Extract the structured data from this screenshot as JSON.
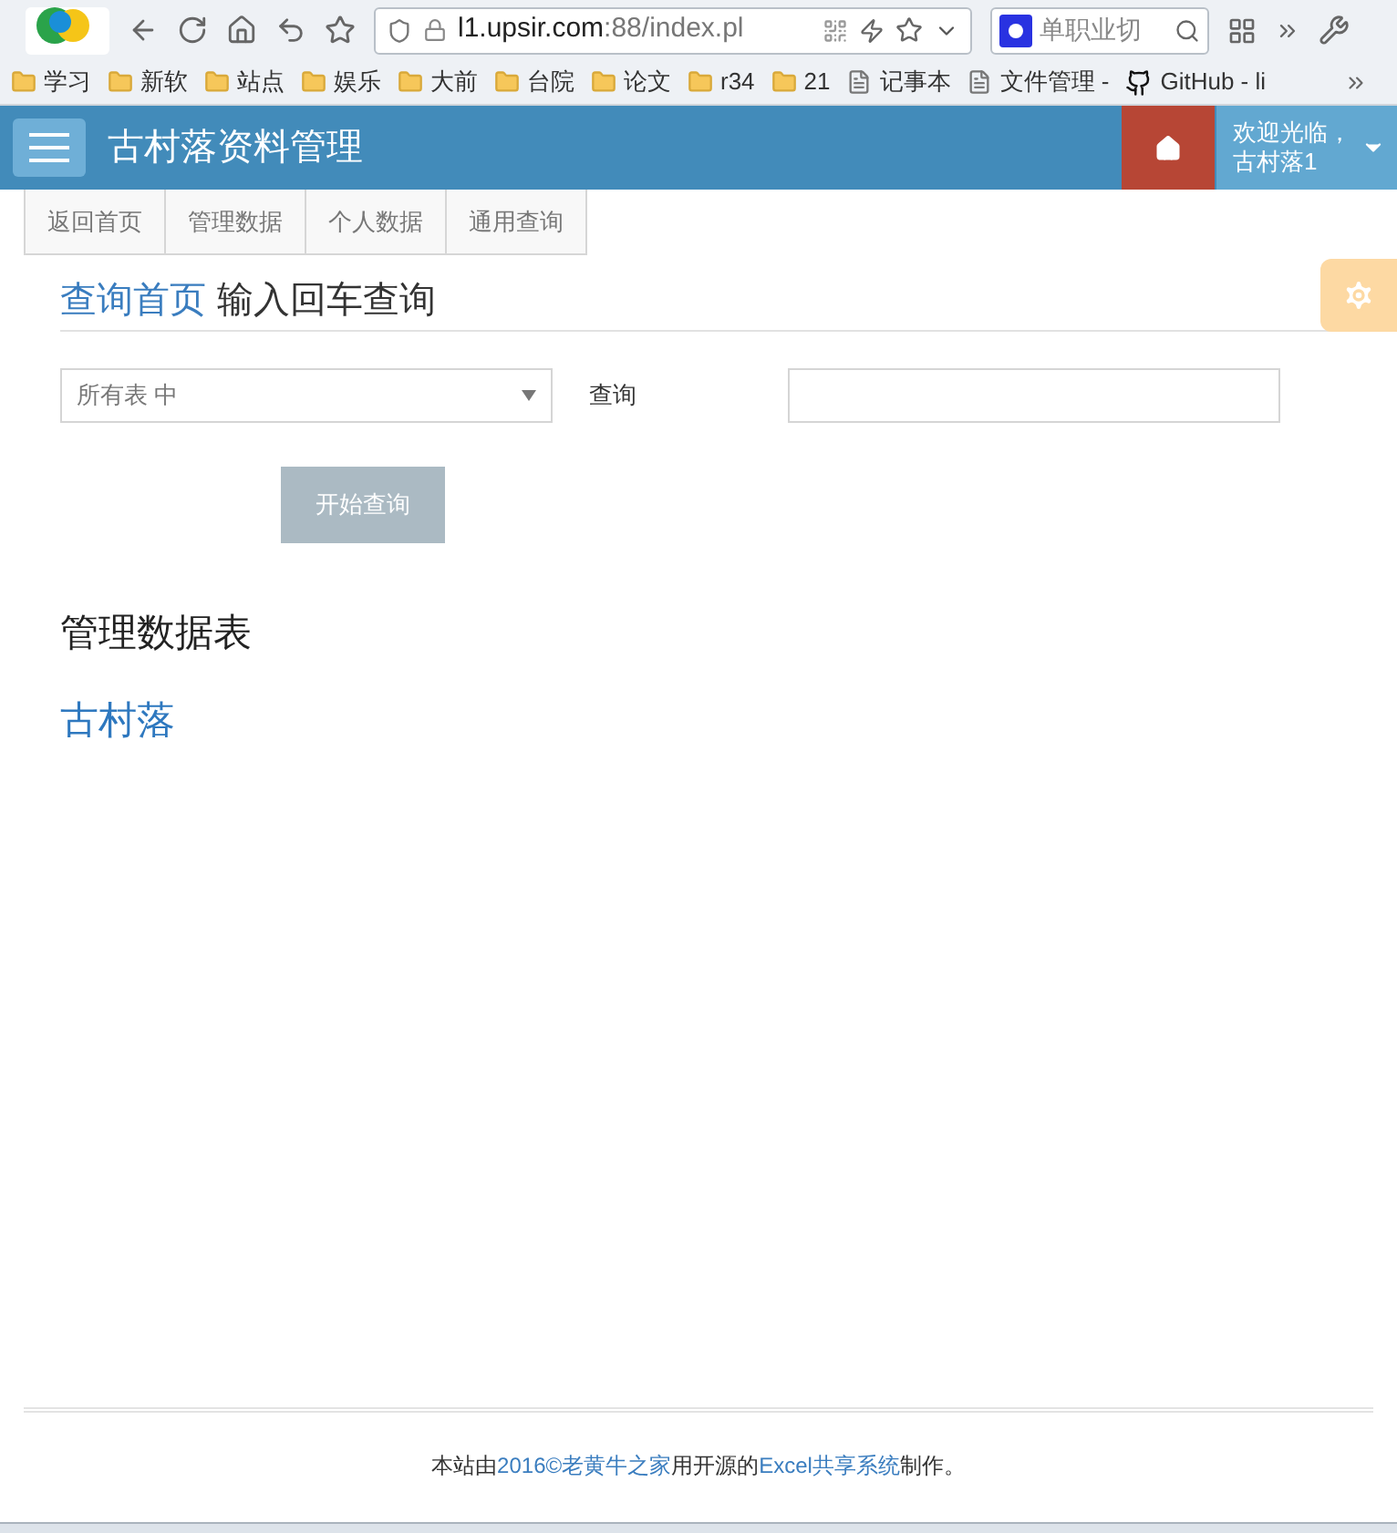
{
  "browser": {
    "url_host": "l1.upsir.com",
    "url_rest": ":88/index.pl",
    "search_placeholder": "单职业切",
    "bookmarks": [
      {
        "label": "学习",
        "kind": "folder"
      },
      {
        "label": "新软",
        "kind": "folder"
      },
      {
        "label": "站点",
        "kind": "folder"
      },
      {
        "label": "娱乐",
        "kind": "folder"
      },
      {
        "label": "大前",
        "kind": "folder"
      },
      {
        "label": "台院",
        "kind": "folder"
      },
      {
        "label": "论文",
        "kind": "folder"
      },
      {
        "label": "r34",
        "kind": "folder"
      },
      {
        "label": "21",
        "kind": "folder"
      },
      {
        "label": "记事本",
        "kind": "page"
      },
      {
        "label": "文件管理 -",
        "kind": "page"
      },
      {
        "label": "GitHub - li",
        "kind": "github"
      }
    ]
  },
  "header": {
    "title": "古村落资料管理",
    "welcome": "欢迎光临，",
    "user": "古村落1"
  },
  "tabs": [
    {
      "label": "返回首页"
    },
    {
      "label": "管理数据"
    },
    {
      "label": "个人数据"
    },
    {
      "label": "通用查询"
    }
  ],
  "page_heading": {
    "link": "查询首页",
    "text": "输入回车查询"
  },
  "query": {
    "select_value": "所有表 中",
    "label": "查询",
    "button": "开始查询"
  },
  "section_title": "管理数据表",
  "tables": [
    "古村落"
  ],
  "footer": [
    {
      "text": "本站由",
      "link": false
    },
    {
      "text": "2016©老黄牛之家",
      "link": true
    },
    {
      "text": "用开源的",
      "link": false
    },
    {
      "text": "Excel共享系统",
      "link": true
    },
    {
      "text": "制作。",
      "link": false
    }
  ]
}
